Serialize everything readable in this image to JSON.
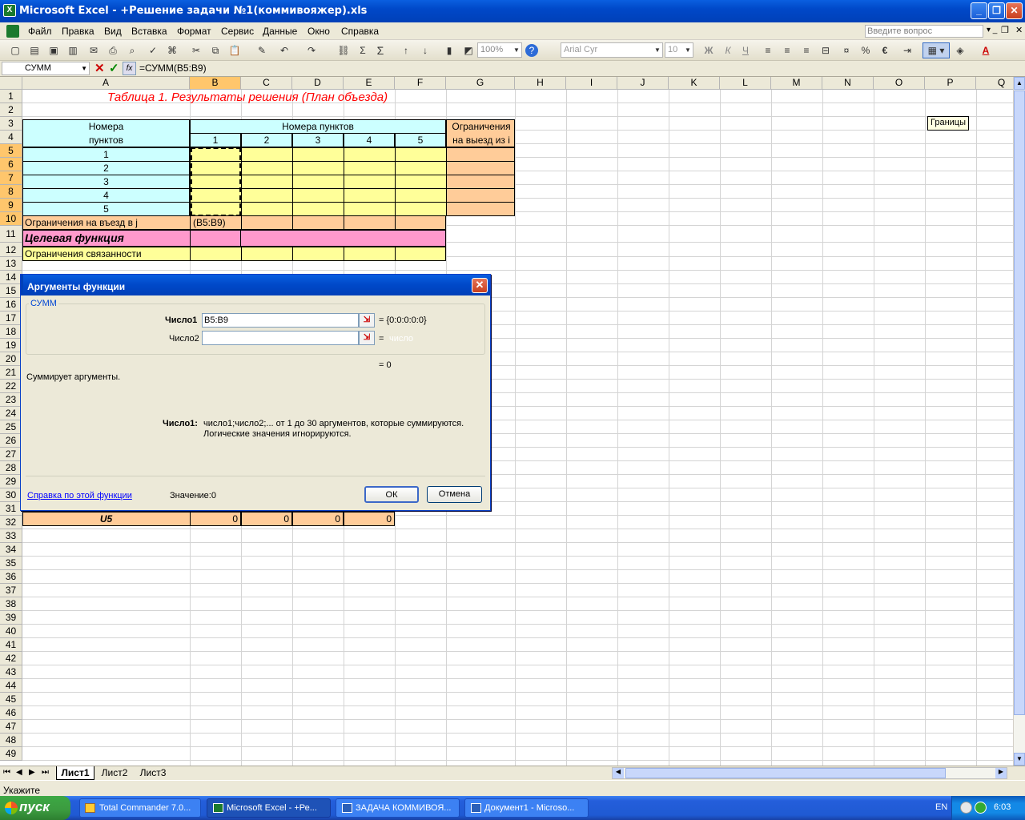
{
  "window": {
    "title": "Microsoft Excel - +Решение задачи №1(коммивояжер).xls"
  },
  "menu": [
    "Файл",
    "Правка",
    "Вид",
    "Вставка",
    "Формат",
    "Сервис",
    "Данные",
    "Окно",
    "Справка"
  ],
  "ask_placeholder": "Введите вопрос",
  "toolbar": {
    "zoom": "100%",
    "font": "Arial Cyr",
    "size": "10",
    "tooltip": "Границы"
  },
  "formula_bar": {
    "name_box": "СУММ",
    "fx": "fx",
    "formula": "=СУММ(B5:B9)"
  },
  "columns": [
    "A",
    "B",
    "C",
    "D",
    "E",
    "F",
    "G",
    "H",
    "I",
    "J",
    "K",
    "L",
    "M",
    "N",
    "O",
    "P",
    "Q"
  ],
  "rows": [
    "1",
    "2",
    "3",
    "4",
    "5",
    "6",
    "7",
    "8",
    "9",
    "10",
    "11",
    "12",
    "13",
    "14",
    "15",
    "16",
    "17",
    "18",
    "19",
    "20",
    "21",
    "22",
    "23",
    "24",
    "25",
    "26",
    "27",
    "28",
    "29",
    "30",
    "31",
    "32",
    "33",
    "34",
    "35",
    "36",
    "37",
    "38",
    "39",
    "40",
    "41",
    "42",
    "43",
    "44",
    "45",
    "46",
    "47",
    "48",
    "49"
  ],
  "sheet": {
    "title": "Таблица 1. Результаты решения (План объезда)",
    "hdr_a1": "Номера",
    "hdr_a2": "пунктов",
    "hdr_points": "Номера пунктов",
    "hdr_limit1": "Ограничения",
    "hdr_limit2": "на выезд из i",
    "col_nums": [
      "1",
      "2",
      "3",
      "4",
      "5"
    ],
    "row_nums": [
      "1",
      "2",
      "3",
      "4",
      "5"
    ],
    "row10": "Ограничения на въезд в j",
    "edit_ref": "(B5:B9)",
    "row11": "Целевая функция",
    "row12": "Ограничения связанности",
    "row31_label": "U5",
    "row31_values": [
      "0",
      "0",
      "0",
      "0"
    ]
  },
  "dialog": {
    "title": "Аргументы функции",
    "group": "СУММ",
    "arg1_label": "Число1",
    "arg1_value": "B5:B9",
    "arg1_result": "= {0:0:0:0:0}",
    "arg2_label": "Число2",
    "arg2_result": "=",
    "arg2_hint": "число",
    "total": "= 0",
    "description": "Суммирует аргументы.",
    "param_label": "Число1:",
    "param_desc1": "число1;число2;... от 1 до 30 аргументов, которые суммируются.",
    "param_desc2": "Логические значения игнорируются.",
    "help_link": "Справка по этой функции",
    "value_label": "Значение:",
    "value": "0",
    "ok": "ОК",
    "cancel": "Отмена"
  },
  "tabs": [
    "Лист1",
    "Лист2",
    "Лист3"
  ],
  "status": "Укажите",
  "taskbar": {
    "start": "пуск",
    "tasks": [
      "Total Commander 7.0...",
      "Microsoft Excel - +Ре...",
      "ЗАДАЧА КОММИВОЯ...",
      "Документ1 - Microso..."
    ],
    "lang": "EN",
    "time": "6:03"
  },
  "colors": {
    "cyan": "#ccffff",
    "yellow": "#ffff99",
    "orange": "#ffcc99",
    "pink": "#ff99cc",
    "title_red": "#ff0000"
  }
}
